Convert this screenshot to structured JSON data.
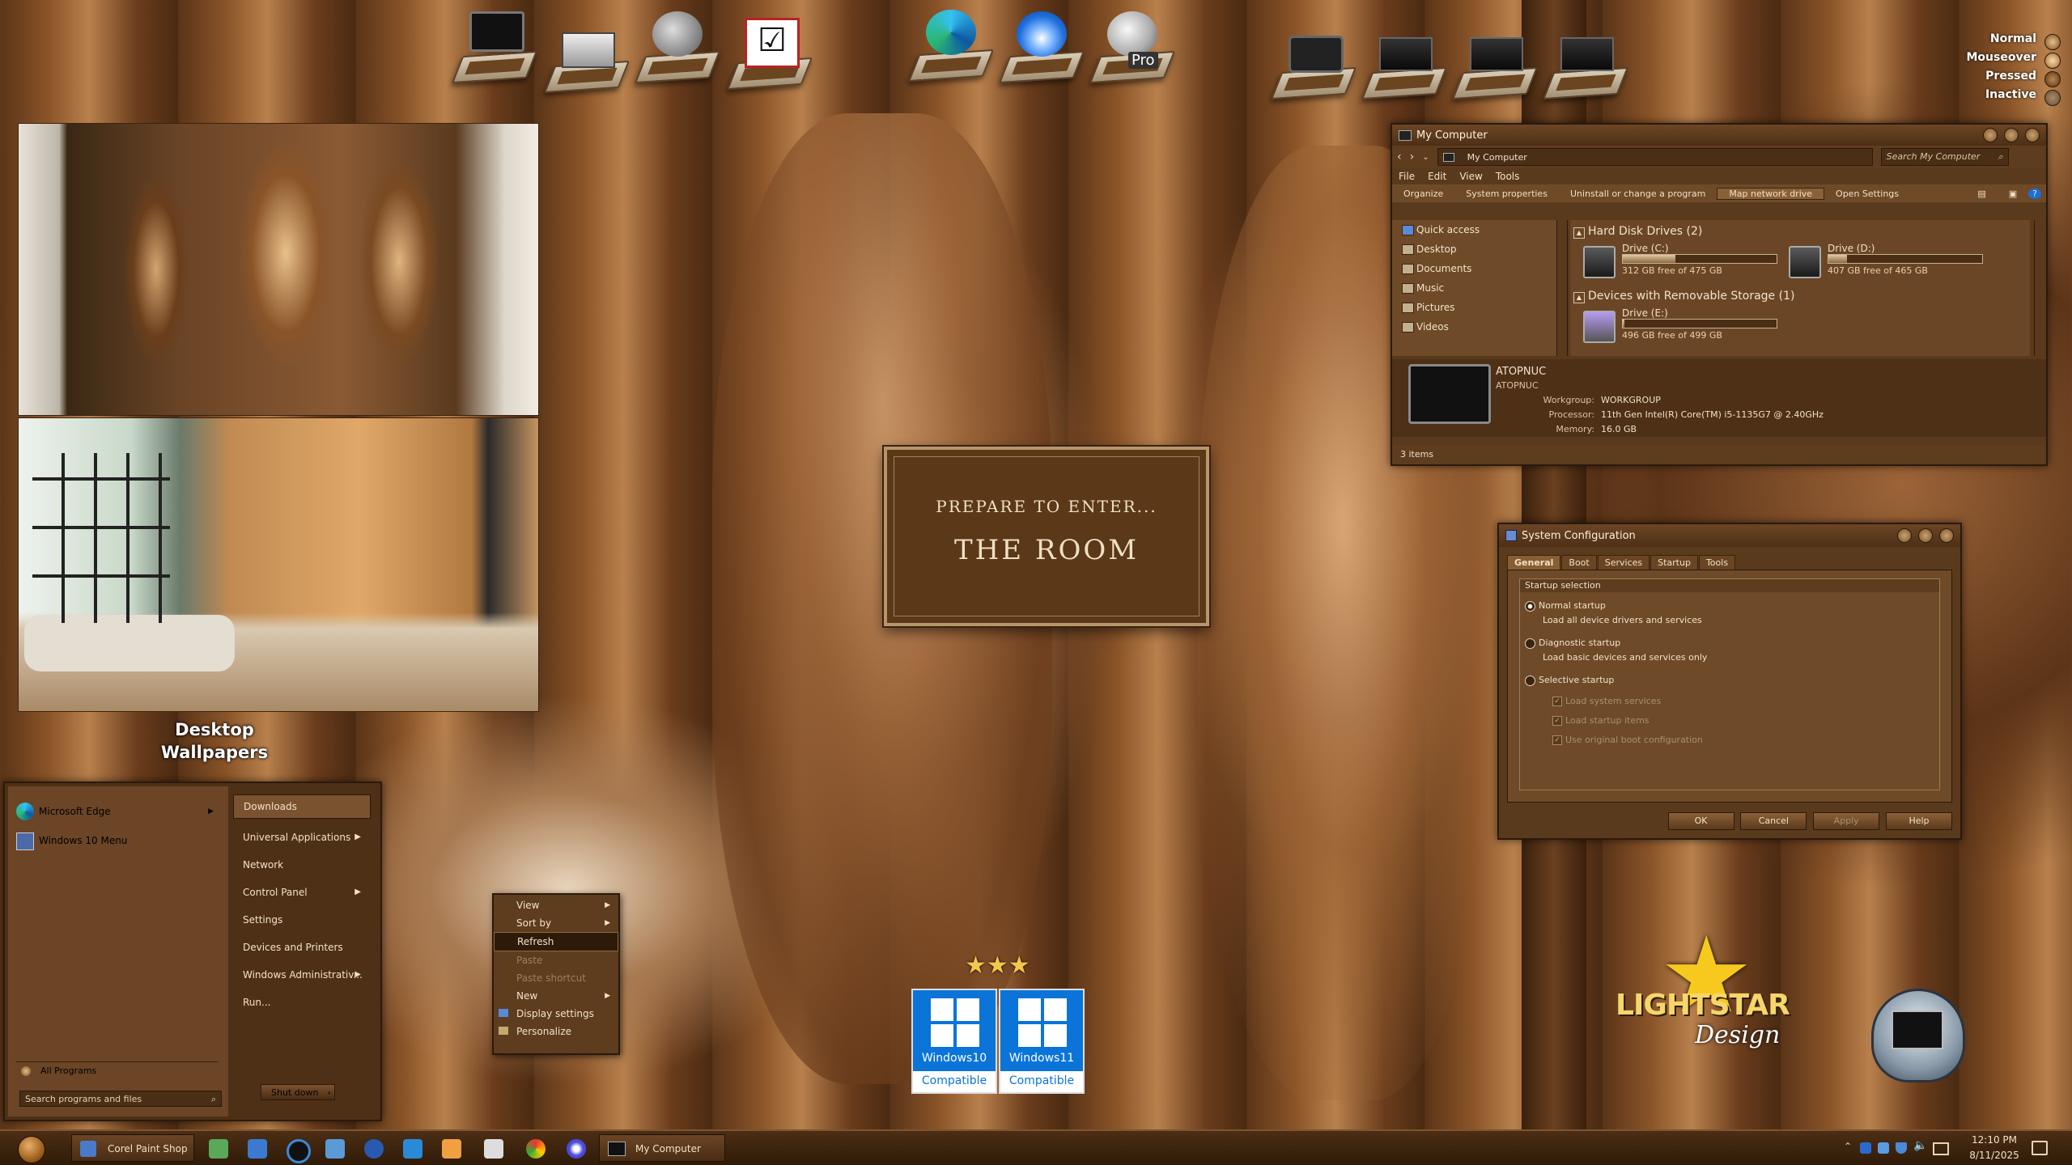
{
  "colors": {
    "wood_dark": "#4e3016",
    "wood_mid": "#6b4526",
    "accent_cream": "#f3e3c9",
    "win_blue": "#0a74d8"
  },
  "state_legend": [
    "Normal",
    "Mouseover",
    "Pressed",
    "Inactive"
  ],
  "desktop_icons": [
    "monitor-icon",
    "printer-icon",
    "satellite-dish-icon",
    "checklist-icon",
    "edge-icon",
    "thunderbird-icon",
    "google-earth-pro-icon",
    "camera-icon",
    "folder-dark-icon",
    "folder-dark-icon",
    "folder-dark-icon"
  ],
  "earth_badge": "Pro",
  "preview_label": "Desktop\nWallpapers",
  "plaque": {
    "line1": "PREPARE TO ENTER...",
    "line2": "THE ROOM"
  },
  "badges": [
    {
      "os": "Windows10",
      "sub": "Compatible"
    },
    {
      "os": "Windows11",
      "sub": "Compatible"
    }
  ],
  "brand": {
    "name": "LIGHTSTAR",
    "script": "Design"
  },
  "my_computer": {
    "title": "My Computer",
    "address": "My Computer",
    "search_placeholder": "Search My Computer",
    "menu": [
      "File",
      "Edit",
      "View",
      "Tools"
    ],
    "commands": [
      "Organize",
      "System properties",
      "Uninstall or change a program",
      "Map network drive",
      "Open Settings"
    ],
    "nav": [
      "Quick access",
      "Desktop",
      "Documents",
      "Music",
      "Pictures",
      "Videos"
    ],
    "hdd_header": "Hard Disk Drives (2)",
    "removable_header": "Devices with Removable Storage (1)",
    "drives": [
      {
        "name": "Drive (C:)",
        "free": "312 GB free of 475 GB",
        "used_fraction": 0.34
      },
      {
        "name": "Drive (D:)",
        "free": "407 GB free of 465 GB",
        "used_fraction": 0.12
      },
      {
        "name": "Drive (E:)",
        "free": "496 GB free of 499 GB",
        "used_fraction": 0.01
      }
    ],
    "details": {
      "name": "ATOPNUC",
      "sub": "ATOPNUC",
      "workgroup_label": "Workgroup:",
      "workgroup": "WORKGROUP",
      "processor_label": "Processor:",
      "processor": "11th Gen Intel(R) Core(TM) i5-1135G7 @ 2.40GHz",
      "memory_label": "Memory:",
      "memory": "16.0 GB"
    },
    "status": "3 items"
  },
  "sysconfig": {
    "title": "System Configuration",
    "tabs": [
      "General",
      "Boot",
      "Services",
      "Startup",
      "Tools"
    ],
    "group": "Startup selection",
    "normal": "Normal startup",
    "normal_desc": "Load all device drivers and services",
    "diag": "Diagnostic startup",
    "diag_desc": "Load basic devices and services only",
    "selective": "Selective startup",
    "checks": [
      "Load system services",
      "Load startup items",
      "Use original boot configuration"
    ],
    "buttons": [
      "OK",
      "Cancel",
      "Apply",
      "Help"
    ]
  },
  "start_menu": {
    "pinned": [
      "Microsoft Edge",
      "Windows 10 Menu"
    ],
    "all_programs": "All Programs",
    "search_placeholder": "Search programs and files",
    "right": [
      "Downloads",
      "Universal Applications",
      "Network",
      "Control Panel",
      "Settings",
      "Devices and Printers",
      "Windows Administrativ...",
      "Run..."
    ],
    "shutdown": "Shut down"
  },
  "context_menu": {
    "items": [
      "View",
      "Sort by",
      "Refresh",
      "Paste",
      "Paste shortcut",
      "New",
      "Display settings",
      "Personalize"
    ]
  },
  "taskbar": {
    "item1": "Corel Paint Shop P...",
    "item2": "My Computer",
    "time": "12:10 PM",
    "date": "8/11/2025"
  }
}
